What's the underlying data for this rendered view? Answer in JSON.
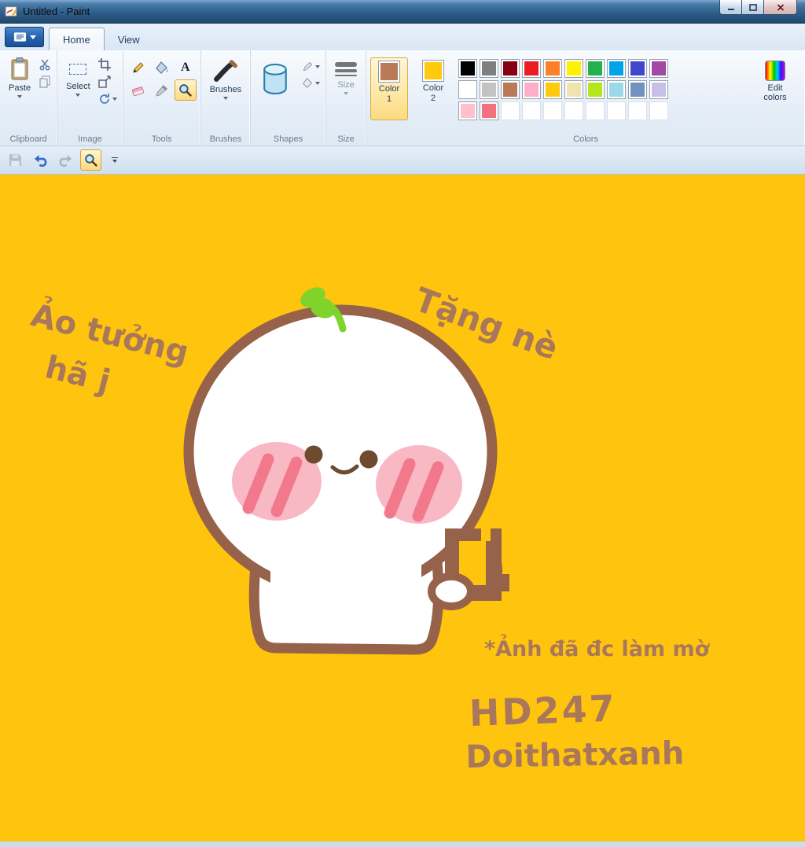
{
  "colors": {
    "canvas_bg": "#FEC40E",
    "ink_brown": "#A9775A",
    "outline_brown": "#96624A",
    "cheek_pink": "#F8B9C5",
    "stripe_pink": "#F2798B",
    "eye_brown": "#6E4B2E",
    "sprout_green": "#7FD32A"
  },
  "titlebar": {
    "title": "Untitled - Paint"
  },
  "tabs": {
    "home": "Home",
    "view": "View"
  },
  "ribbon": {
    "clipboard": {
      "label": "Clipboard",
      "paste": "Paste"
    },
    "image": {
      "label": "Image",
      "select": "Select"
    },
    "tools": {
      "label": "Tools",
      "text_tool_glyph": "A"
    },
    "brushes": {
      "label": "Brushes"
    },
    "shapes": {
      "label": "Shapes"
    },
    "size": {
      "label": "Size"
    },
    "colors_group": {
      "label": "Colors",
      "color1_line1": "Color",
      "color1_line2": "1",
      "color1_value": "#B97A57",
      "color2_line1": "Color",
      "color2_line2": "2",
      "color2_value": "#FFC90E",
      "edit_colors": "Edit colors",
      "palette": [
        "#000000",
        "#7F7F7F",
        "#880015",
        "#ED1C24",
        "#FF7F27",
        "#FFF200",
        "#22B14C",
        "#00A2E8",
        "#3F48CC",
        "#A349A4",
        "#FFFFFF",
        "#C3C3C3",
        "#B97A57",
        "#FFAEC9",
        "#FFC90E",
        "#EFE4B0",
        "#B5E61D",
        "#99D9EA",
        "#7092BE",
        "#C8BFE7",
        "#FFC0CB",
        "#F4707E",
        "",
        "",
        "",
        "",
        "",
        "",
        "",
        ""
      ]
    }
  },
  "canvas_texts": {
    "top_left_1": "Ảo tưởng",
    "top_left_2": "hã j",
    "top_right": "Tặng nè",
    "note": "*Ảnh đã đc làm mờ",
    "signature_1": "HD247",
    "signature_2": "Doithatxanh"
  }
}
